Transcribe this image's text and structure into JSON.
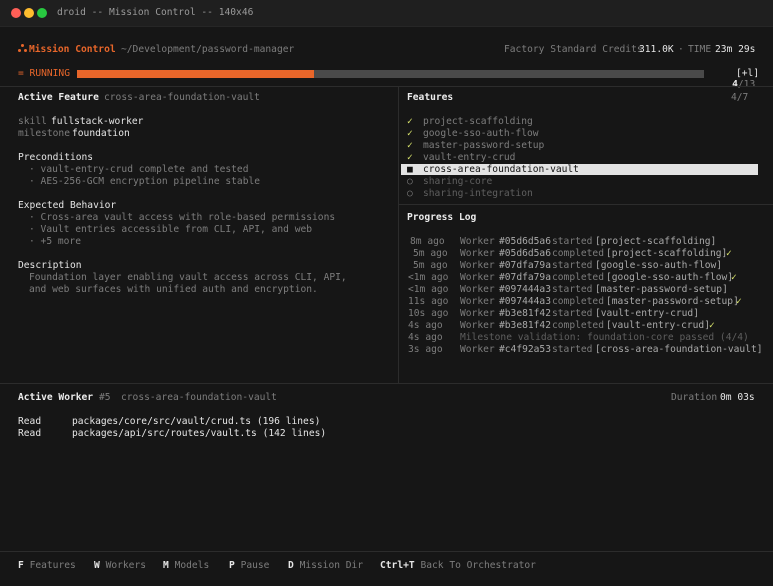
{
  "window": {
    "title": "droid -- Mission Control -- 140x46"
  },
  "header": {
    "app_name": "Mission Control",
    "path": "~/Development/password-manager",
    "credits_label": "Factory Standard Credits",
    "credits_value": "311.0K",
    "separator": "·",
    "time_label": "TIME",
    "time_value": "23m 29s"
  },
  "status": {
    "label": "= RUNNING",
    "progress_current": "4",
    "progress_total": "/13",
    "progress_fraction": 0.3077,
    "expand": "[+l]"
  },
  "active_feature": {
    "heading": "Active Feature",
    "name": "cross-area-foundation-vault",
    "skill_label": "skill",
    "skill_value": "fullstack-worker",
    "milestone_label": "milestone",
    "milestone_value": "foundation",
    "preconditions_heading": "Preconditions",
    "preconditions": [
      "· vault-entry-crud complete and tested",
      "· AES-256-GCM encryption pipeline stable"
    ],
    "expected_heading": "Expected Behavior",
    "expected": [
      "· Cross-area vault access with role-based permissions",
      "· Vault entries accessible from CLI, API, and web",
      "· +5 more"
    ],
    "description_heading": "Description",
    "description_lines": [
      "Foundation layer enabling vault access across CLI, API,",
      "and web surfaces with unified auth and encryption."
    ]
  },
  "features": {
    "heading": "Features",
    "count": "4/7",
    "items": [
      {
        "mark": "✓",
        "name": "project-scaffolding"
      },
      {
        "mark": "✓",
        "name": "google-sso-auth-flow"
      },
      {
        "mark": "✓",
        "name": "master-password-setup"
      },
      {
        "mark": "✓",
        "name": "vault-entry-crud"
      },
      {
        "mark": "■",
        "name": "cross-area-foundation-vault"
      },
      {
        "mark": "○",
        "name": "sharing-core"
      },
      {
        "mark": "○",
        "name": "sharing-integration"
      }
    ]
  },
  "progress_log": {
    "heading": "Progress Log",
    "entries": [
      {
        "time": "8m ago",
        "worker": "Worker",
        "id": "#05d6d5a6",
        "action": "started",
        "target": "[project-scaffolding]",
        "check": ""
      },
      {
        "time": "5m ago",
        "worker": "Worker",
        "id": "#05d6d5a6",
        "action": "completed",
        "target": "[project-scaffolding]",
        "check": "✓"
      },
      {
        "time": "5m ago",
        "worker": "Worker",
        "id": "#07dfa79a",
        "action": "started",
        "target": "[google-sso-auth-flow]",
        "check": ""
      },
      {
        "time": "<1m ago",
        "worker": "Worker",
        "id": "#07dfa79a",
        "action": "completed",
        "target": "[google-sso-auth-flow]",
        "check": "✓"
      },
      {
        "time": "<1m ago",
        "worker": "Worker",
        "id": "#097444a3",
        "action": "started",
        "target": "[master-password-setup]",
        "check": ""
      },
      {
        "time": "11s ago",
        "worker": "Worker",
        "id": "#097444a3",
        "action": "completed",
        "target": "[master-password-setup]",
        "check": "✓"
      },
      {
        "time": "10s ago",
        "worker": "Worker",
        "id": "#b3e81f42",
        "action": "started",
        "target": "[vault-entry-crud]",
        "check": ""
      },
      {
        "time": "4s ago",
        "worker": "Worker",
        "id": "#b3e81f42",
        "action": "completed",
        "target": "[vault-entry-crud]",
        "check": "✓"
      },
      {
        "time": "4s ago",
        "worker": "Milestone validation: foundation-core passed (4/4)",
        "id": "",
        "action": "",
        "target": "",
        "check": ""
      },
      {
        "time": "3s ago",
        "worker": "Worker",
        "id": "#c4f92a53",
        "action": "started",
        "target": "[cross-area-foundation-vault]",
        "check": ""
      }
    ]
  },
  "active_worker": {
    "heading": "Active Worker",
    "number": "#5",
    "feature": "cross-area-foundation-vault",
    "duration_label": "Duration",
    "duration_value": "0m 03s",
    "ops": [
      {
        "op": "Read",
        "path": "packages/core/src/vault/crud.ts (196 lines)"
      },
      {
        "op": "Read",
        "path": "packages/api/src/routes/vault.ts (142 lines)"
      }
    ]
  },
  "footer": {
    "items": [
      {
        "key": "F",
        "label": "Features"
      },
      {
        "key": "W",
        "label": "Workers"
      },
      {
        "key": "M",
        "label": "Models"
      },
      {
        "key": "P",
        "label": "Pause"
      },
      {
        "key": "D",
        "label": "Mission Dir"
      },
      {
        "key": "Ctrl+T",
        "label": "Back To Orchestrator"
      }
    ]
  },
  "colors": {
    "accent": "#e8662a",
    "check": "#d8e36b",
    "highlight": "#e3e3e3"
  }
}
